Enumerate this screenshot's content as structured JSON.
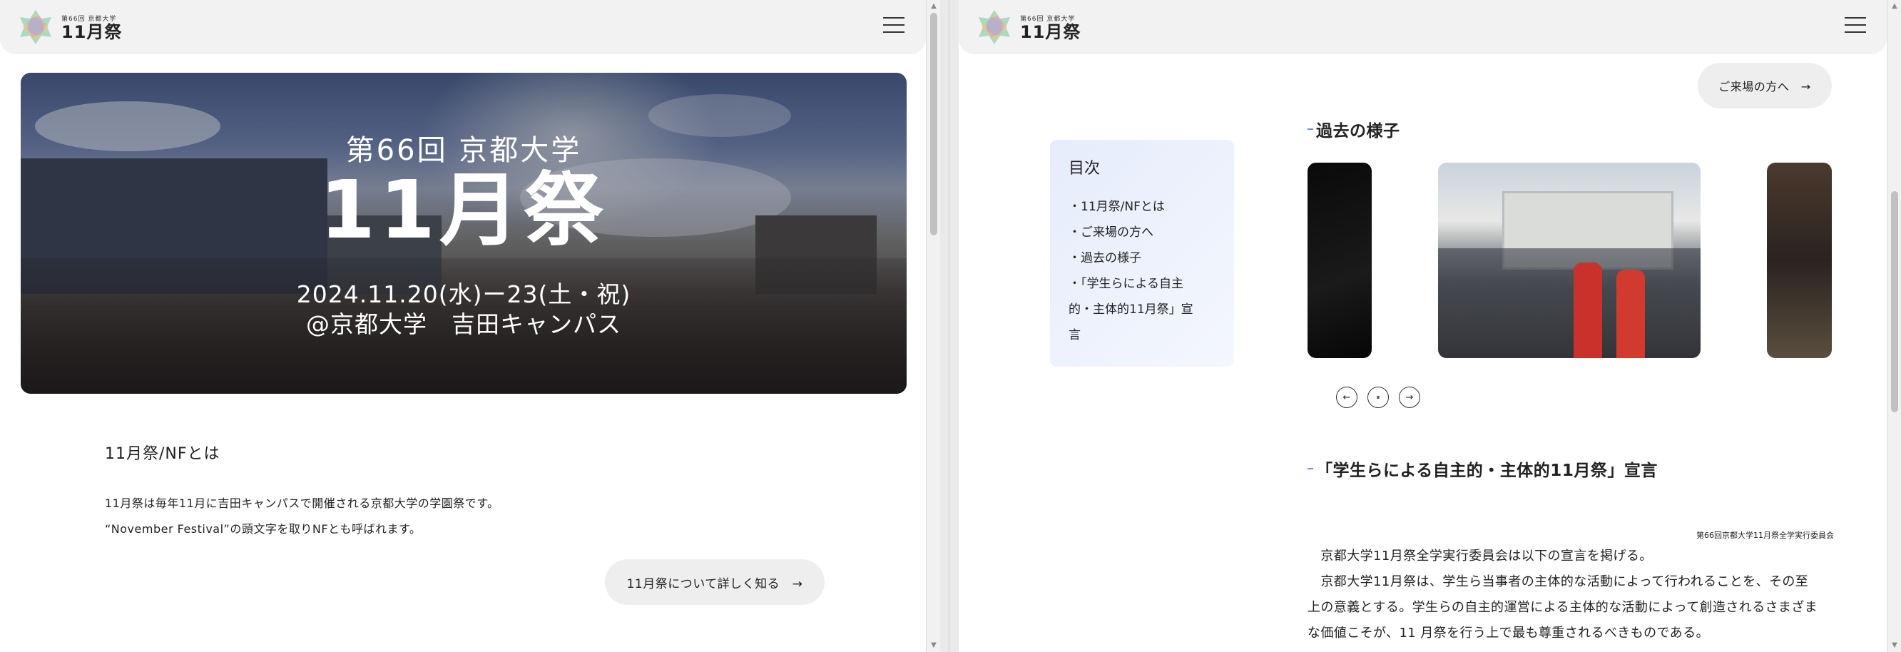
{
  "left": {
    "header": {
      "logo_sub": "第66回 京都大学",
      "logo_main": "11月祭"
    },
    "hero": {
      "edition": "第66回 京都大学",
      "title": "11月祭",
      "date": "2024.11.20(水)ー23(土・祝)",
      "venue": "@京都大学　吉田キャンパス"
    },
    "about": {
      "title": "11月祭/NFとは",
      "line1": "11月祭は毎年11月に吉田キャンパスで開催される京都大学の学園祭です。",
      "line2": "“November Festival”の頭文字を取りNFとも呼ばれます。",
      "button": "11月祭について詳しく知る　→"
    }
  },
  "right": {
    "header": {
      "logo_sub": "第66回 京都大学",
      "logo_main": "11月祭"
    },
    "visitor_button": "ご来場の方へ　→",
    "toc": {
      "title": "目次",
      "items": [
        "・11月祭/NFとは",
        "・ご来場の方へ",
        "・過去の様子",
        "・「学生らによる自主",
        "的・主体的11月祭」宣",
        "言"
      ]
    },
    "past_title": "過去の様子",
    "slider": {
      "prev_icon": "←",
      "pause_icon": "⏸",
      "next_icon": "→"
    },
    "declaration": {
      "title": "「学生らによる自主的・主体的11月祭」宣言",
      "committee": "第66回京都大学11月祭全学実行委員会",
      "p1": "　京都大学11月祭全学実行委員会は以下の宣言を掲げる。",
      "p2a": "　京都大学11月祭は、学生ら当事者の主体的な活動によって行われることを、その至",
      "p2b": "上の意義とする。学生らの自主的運営による主体的な活動によって創造されるさまざま",
      "p2c": "な価値こそが、11 月祭を行う上で最も尊重されるべきものである。"
    }
  },
  "colors": {
    "header_bg": "#f2f2f2",
    "toc_bg": "#e6ecfb",
    "accent_dash": "#6d8fd8",
    "pill_bg": "#eeeeee"
  }
}
